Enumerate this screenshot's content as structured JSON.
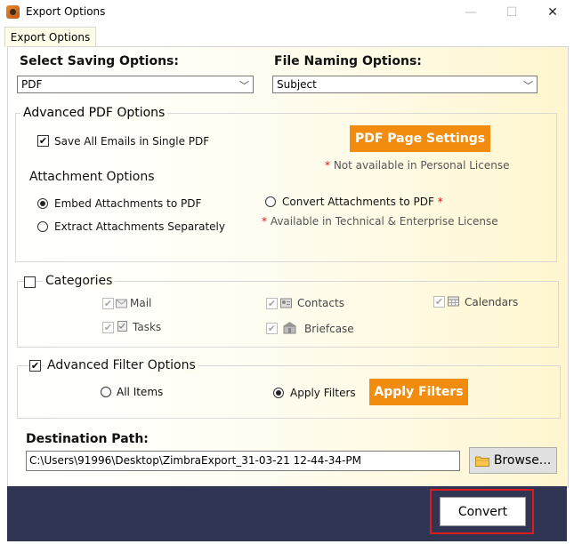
{
  "window": {
    "title": "Export Options",
    "minimize_glyph": "—",
    "maximize_glyph": "☐",
    "close_glyph": "✕"
  },
  "tab": {
    "label": "Export Options"
  },
  "saving": {
    "label": "Select Saving Options:",
    "value": "PDF"
  },
  "naming": {
    "label": "File Naming Options:",
    "value": "Subject"
  },
  "pdf_options": {
    "title": "Advanced PDF Options",
    "save_single_label": "Save All Emails in Single PDF",
    "save_single_checked": true,
    "page_settings_label": "PDF Page Settings",
    "page_settings_note": "Not available in Personal License",
    "attachment_title": "Attachment Options",
    "embed_label": "Embed Attachments to PDF",
    "extract_label": "Extract Attachments Separately",
    "convert_label": "Convert Attachments to PDF",
    "convert_note": "Available in Technical & Enterprise License",
    "required_mark": "*"
  },
  "categories": {
    "title": "Categories",
    "checked": false,
    "items": [
      {
        "label": "Mail",
        "icon": "mail-icon"
      },
      {
        "label": "Contacts",
        "icon": "contacts-icon"
      },
      {
        "label": "Calendars",
        "icon": "calendar-icon"
      },
      {
        "label": "Tasks",
        "icon": "tasks-icon"
      },
      {
        "label": "Briefcase",
        "icon": "briefcase-icon"
      }
    ]
  },
  "filter": {
    "title": "Advanced Filter Options",
    "checked": true,
    "all_items_label": "All Items",
    "apply_filters_radio_label": "Apply Filters",
    "apply_filters_button_label": "Apply Filters"
  },
  "destination": {
    "label": "Destination Path:",
    "value": "C:\\Users\\91996\\Desktop\\ZimbraExport_31-03-21 12-44-34-PM",
    "browse_label": "Browse..."
  },
  "convert_label": "Convert",
  "colors": {
    "accent_orange": "#f18c0e",
    "footer_navy": "#2f3553",
    "highlight_red": "#e01b1b",
    "required_red": "#d11111"
  }
}
